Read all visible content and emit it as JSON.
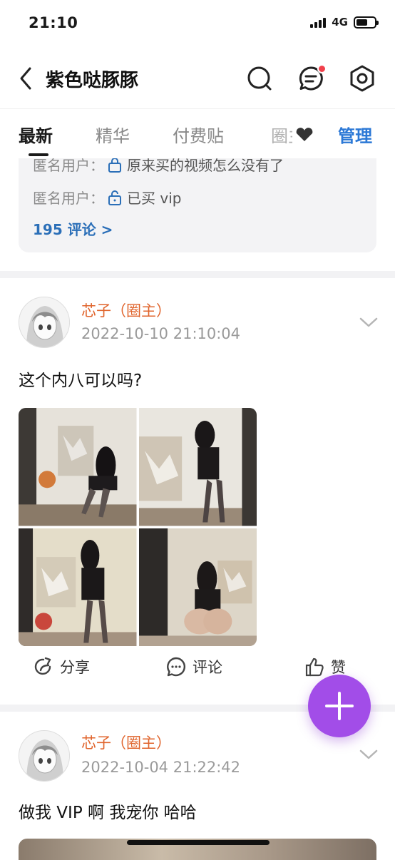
{
  "status": {
    "time": "21:10",
    "network": "4G"
  },
  "header": {
    "title": "紫色哒豚豚",
    "back_icon": "chevron-left-icon",
    "icons": [
      "search-icon",
      "message-icon",
      "settings-icon"
    ]
  },
  "tabs": {
    "items": [
      "最新",
      "精华",
      "付费贴"
    ],
    "truncated": "圈主",
    "manage": "管理",
    "active_index": 0
  },
  "comments": {
    "rows": [
      {
        "user": "匿名用户：",
        "text": "原来买的视频怎么没有了"
      },
      {
        "user": "匿名用户：",
        "text": "已买 vip"
      }
    ],
    "more": "195 评论 >"
  },
  "posts": [
    {
      "author": "芯子（圈主）",
      "time": "2022-10-10 21:10:04",
      "text": "这个内八可以吗?",
      "images": 4
    },
    {
      "author": "芯子（圈主）",
      "time": "2022-10-04 21:22:42",
      "text": "做我 VIP 啊 我宠你 哈哈"
    }
  ],
  "actions": {
    "share": "分享",
    "comment": "评论",
    "like": "赞"
  },
  "colors": {
    "accent": "#2b78d6",
    "author": "#e0642c",
    "fab": "#a24de8",
    "badge": "#f1404b"
  }
}
